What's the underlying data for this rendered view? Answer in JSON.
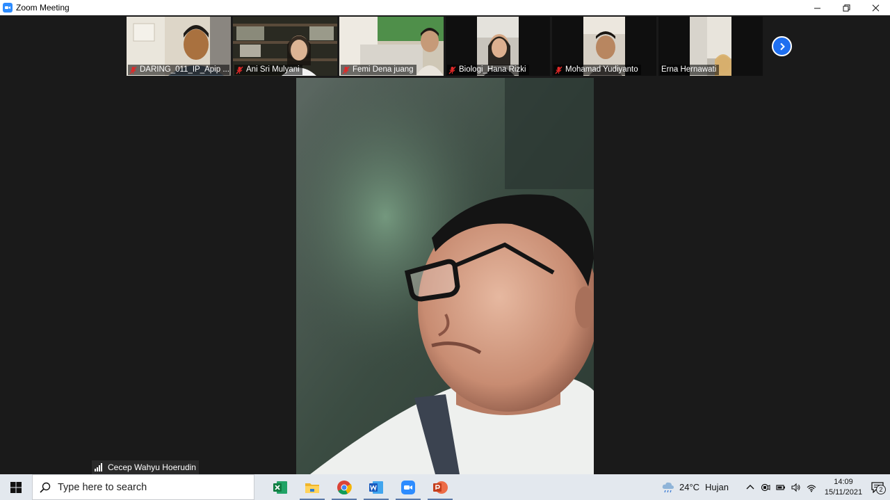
{
  "window": {
    "title": "Zoom Meeting"
  },
  "participants": [
    {
      "name": "DARING_011_IP_Apip ...",
      "muted": true
    },
    {
      "name": "Ani Sri Mulyani",
      "muted": true
    },
    {
      "name": "Femi Dena juang",
      "muted": true
    },
    {
      "name": "Biologi_Hana Rizki",
      "muted": true
    },
    {
      "name": "Mohamad Yudiyanto",
      "muted": true
    },
    {
      "name": "Erna Hernawati",
      "muted": false
    }
  ],
  "active_speaker": {
    "name": "Cecep Wahyu Hoerudin"
  },
  "taskbar": {
    "search_placeholder": "Type here to search",
    "apps": [
      "excel-icon",
      "file-explorer-icon",
      "chrome-icon",
      "word-icon",
      "zoom-icon",
      "powerpoint-icon"
    ],
    "weather": {
      "temp": "24°C",
      "condition": "Hujan"
    },
    "time": "14:09",
    "date": "15/11/2021",
    "notification_count": "2"
  },
  "colors": {
    "zoom_blue": "#2d8cff",
    "mute_red": "#e02828",
    "stage_bg": "#1a1a1a",
    "taskbar_bg": "#e3e8ee"
  }
}
